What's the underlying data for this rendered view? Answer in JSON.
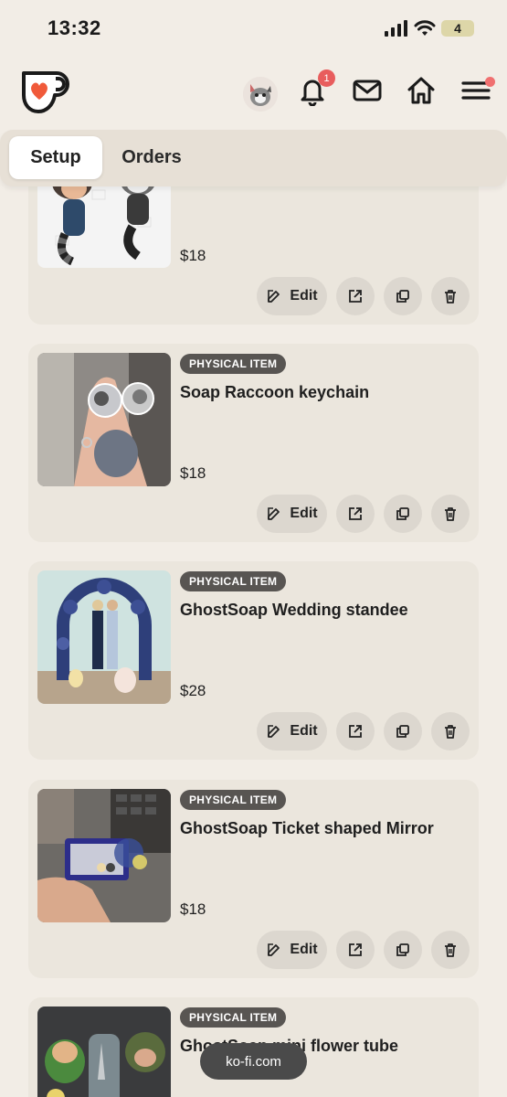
{
  "status_bar": {
    "time": "13:32",
    "battery": "4"
  },
  "header": {
    "notification_count": "1",
    "brand_color": "#f05a3a"
  },
  "tabs": [
    {
      "label": "Setup"
    },
    {
      "label": "Orders"
    }
  ],
  "products": [
    {
      "tag": "",
      "title": "",
      "price": "$18"
    },
    {
      "tag": "PHYSICAL ITEM",
      "title": "Soap Raccoon keychain",
      "price": "$18"
    },
    {
      "tag": "PHYSICAL ITEM",
      "title": "GhostSoap Wedding standee",
      "price": "$28"
    },
    {
      "tag": "PHYSICAL ITEM",
      "title": "GhostSoap Ticket shaped Mirror",
      "price": "$18"
    },
    {
      "tag": "PHYSICAL ITEM",
      "title": "GhostSoap mini flower tube",
      "price": ""
    }
  ],
  "actions": {
    "edit_label": "Edit"
  },
  "browser": {
    "url": "ko-fi.com"
  }
}
